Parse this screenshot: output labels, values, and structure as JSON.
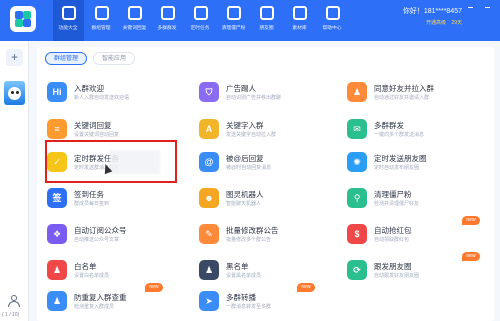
{
  "topbar": {
    "tabs": [
      {
        "label": "功能大全",
        "icon": "grid-icon",
        "active": true
      },
      {
        "label": "群组管理",
        "icon": "layers-icon",
        "active": false
      },
      {
        "label": "关键词回复",
        "icon": "text-icon",
        "active": false
      },
      {
        "label": "多群群发",
        "icon": "message-icon",
        "active": false
      },
      {
        "label": "定时任务",
        "icon": "clock-icon",
        "active": false
      },
      {
        "label": "清理僵尸粉",
        "icon": "broom-icon",
        "active": false
      },
      {
        "label": "朋友圈",
        "icon": "aperture-icon",
        "active": false
      },
      {
        "label": "素材库",
        "icon": "folder-icon",
        "active": false
      },
      {
        "label": "帮助中心",
        "icon": "help-icon",
        "active": false
      }
    ],
    "user": {
      "name": "你好！181****8457",
      "badge_vip": "开通高级",
      "badge_expire": "29天"
    }
  },
  "sidebar": {
    "add_label": "+",
    "pager": "( 1 / 10)"
  },
  "subtabs": [
    {
      "label": "群组管理",
      "active": true
    },
    {
      "label": "智能应用",
      "active": false
    }
  ],
  "features": [
    {
      "title": "入群欢迎",
      "desc": "新人入群自动发送欢迎语",
      "icon": "hi-icon",
      "color": "#3a8cf7",
      "glyph": "Hi",
      "new": false
    },
    {
      "title": "广告踢人",
      "desc": "自动识别广告并移出群聊",
      "icon": "shield-icon",
      "color": "#8a6cf2",
      "glyph": "⛉",
      "new": false
    },
    {
      "title": "同意好友并拉入群",
      "desc": "自动通过好友并邀请入群",
      "icon": "user-add-icon",
      "color": "#ff8a3a",
      "glyph": "♟",
      "new": false
    },
    {
      "title": "关键词回复",
      "desc": "设置关键词自动回复",
      "icon": "chat-icon",
      "color": "#ff9a2e",
      "glyph": "≡",
      "new": false
    },
    {
      "title": "关键字入群",
      "desc": "发送关键字自动拉入群",
      "icon": "a-icon",
      "color": "#f0b528",
      "glyph": "A",
      "new": false
    },
    {
      "title": "多群群发",
      "desc": "一键向多个群发送消息",
      "icon": "mail-icon",
      "color": "#2bbf8f",
      "glyph": "✉",
      "new": false
    },
    {
      "title": "定时群发任务",
      "desc": "定时发送群消息任务",
      "icon": "calendar-check-icon",
      "color": "#f5c518",
      "glyph": "✓",
      "new": false
    },
    {
      "title": "被@后回复",
      "desc": "被@时自动回复消息",
      "icon": "at-icon",
      "color": "#3a8cf7",
      "glyph": "@",
      "new": false
    },
    {
      "title": "定时发送朋友圈",
      "desc": "定时自动发布朋友圈",
      "icon": "aperture-icon",
      "color": "#2a9df4",
      "glyph": "✺",
      "new": false
    },
    {
      "title": "签到任务",
      "desc": "群成员每日签到",
      "icon": "checkin-icon",
      "color": "#2d6ff6",
      "glyph": "签",
      "new": false
    },
    {
      "title": "图灵机器人",
      "desc": "智能聊天机器人",
      "icon": "robot-icon",
      "color": "#f5a623",
      "glyph": "☻",
      "new": false
    },
    {
      "title": "清理僵尸粉",
      "desc": "检测并清理僵尸好友",
      "icon": "broom-icon",
      "color": "#2bbf8f",
      "glyph": "⚲",
      "new": false
    },
    {
      "title": "自动订阅公众号",
      "desc": "自动推送公众号文章",
      "icon": "subscribe-icon",
      "color": "#7a5cf0",
      "glyph": "❖",
      "new": false
    },
    {
      "title": "批量修改群公告",
      "desc": "批量修改多个群公告",
      "icon": "notice-icon",
      "color": "#ff8a3a",
      "glyph": "✎",
      "new": false
    },
    {
      "title": "自动抢红包",
      "desc": "自动领取群红包",
      "icon": "redpacket-icon",
      "color": "#f04848",
      "glyph": "$",
      "new": true
    },
    {
      "title": "白名单",
      "desc": "设置白名单成员",
      "icon": "user-icon",
      "color": "#f04848",
      "glyph": "♟",
      "new": false
    },
    {
      "title": "黑名单",
      "desc": "设置黑名单成员",
      "icon": "user-block-icon",
      "color": "#3a4a66",
      "glyph": "♟",
      "new": false
    },
    {
      "title": "跟发朋友圈",
      "desc": "自动跟发好友朋友圈",
      "icon": "repost-icon",
      "color": "#2bbf8f",
      "glyph": "⟳",
      "new": true
    },
    {
      "title": "防重复入群查重",
      "desc": "检测重复入群成员",
      "icon": "group-check-icon",
      "color": "#3a8cf7",
      "glyph": "♟",
      "new": true
    },
    {
      "title": "多群转播",
      "desc": "一群消息转发至多群",
      "icon": "send-icon",
      "color": "#3a8cf7",
      "glyph": "➤",
      "new": true
    },
    {
      "title": "",
      "desc": "",
      "icon": "",
      "color": "",
      "glyph": "",
      "new": false
    }
  ],
  "new_label": "new"
}
